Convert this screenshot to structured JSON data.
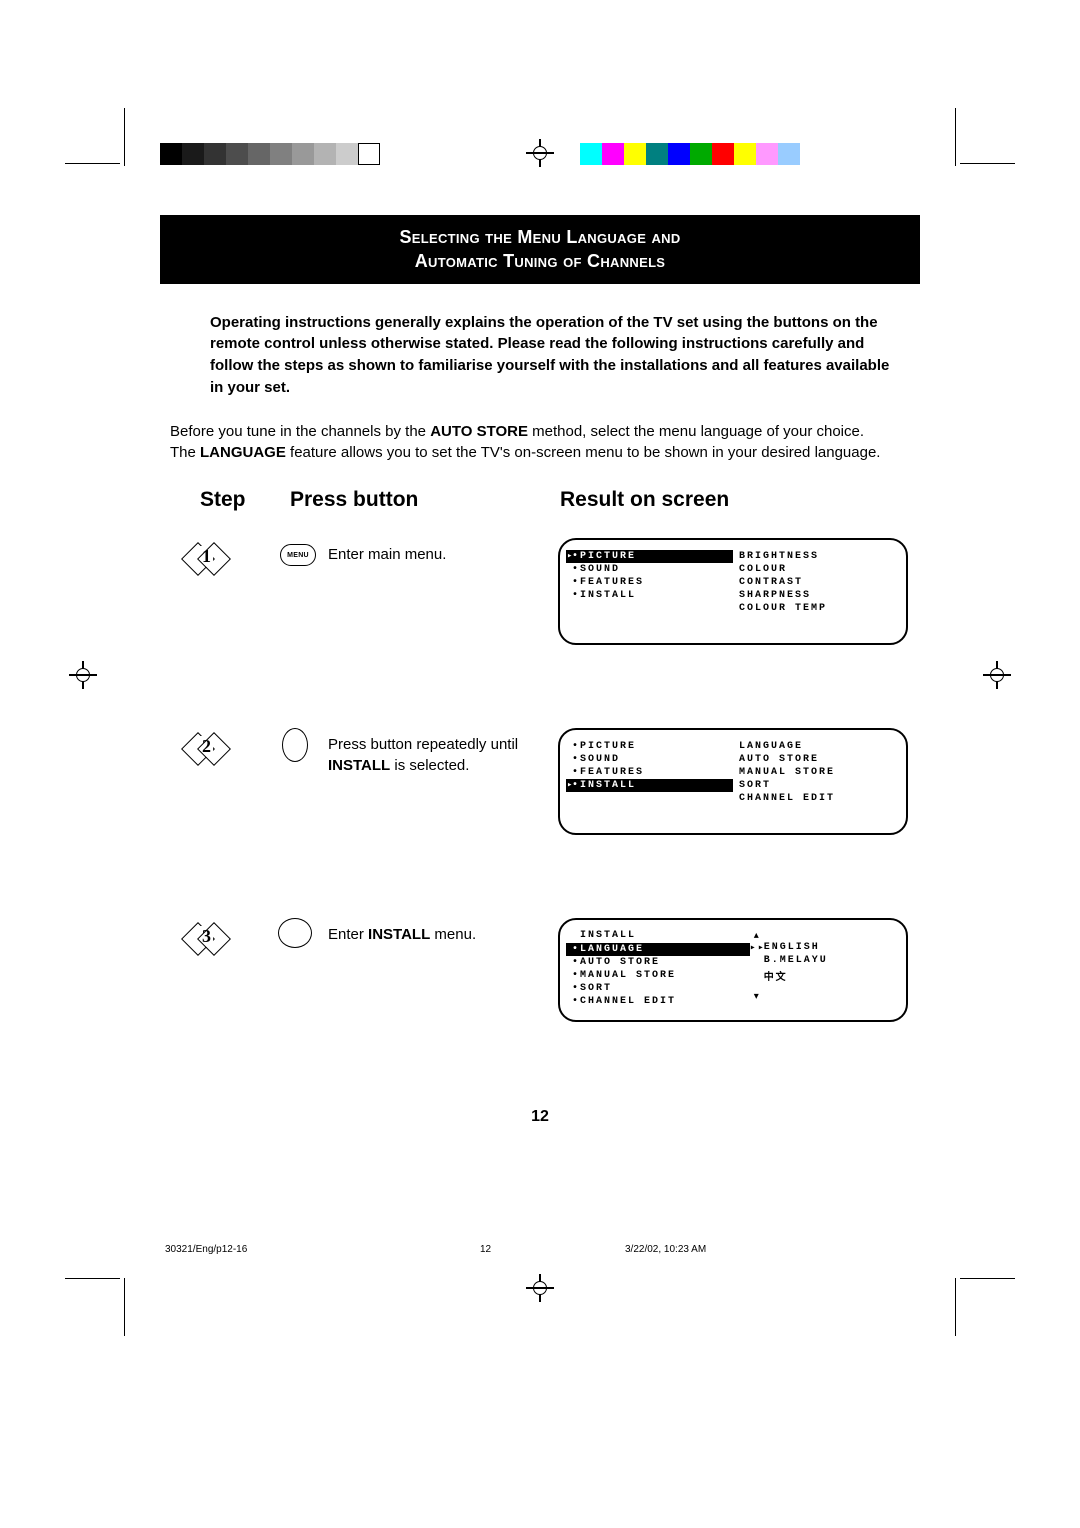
{
  "title": {
    "line1": "Selecting the Menu Language  and",
    "line2": "Automatic Tuning of Channels"
  },
  "intro_bold": "Operating instructions generally explains the operation of the TV set using the buttons on the remote control unless otherwise stated.  Please read the following instructions carefully and follow the steps as shown to familiarise yourself with the installations and all features available in your set.",
  "intro_normal_pre": "Before you tune in the channels by the ",
  "intro_normal_bold1": "AUTO STORE",
  "intro_normal_mid": " method, select the menu language of your choice.  The ",
  "intro_normal_bold2": "LANGUAGE",
  "intro_normal_post": " feature allows you to set the TV's on-screen menu to be shown in your desired language.",
  "headers": {
    "step": "Step",
    "press": "Press button",
    "result": "Result on screen"
  },
  "steps": {
    "s1": {
      "num": "1",
      "btn_label": "MENU",
      "text": "Enter main menu."
    },
    "s2": {
      "num": "2",
      "text_pre": "Press button repeatedly until ",
      "text_bold": "INSTALL",
      "text_post": " is selected."
    },
    "s3": {
      "num": "3",
      "text_pre": "Enter ",
      "text_bold": "INSTALL",
      "text_post": " menu."
    }
  },
  "screen1": {
    "left": [
      "PICTURE",
      "SOUND",
      "FEATURES",
      "INSTALL"
    ],
    "left_selected": 0,
    "right": [
      "BRIGHTNESS",
      "COLOUR",
      "CONTRAST",
      "SHARPNESS",
      "COLOUR TEMP"
    ]
  },
  "screen2": {
    "left": [
      "PICTURE",
      "SOUND",
      "FEATURES",
      "INSTALL"
    ],
    "left_selected": 3,
    "right": [
      "LANGUAGE",
      "AUTO STORE",
      "MANUAL STORE",
      "SORT",
      "CHANNEL EDIT"
    ]
  },
  "screen3": {
    "head": "INSTALL",
    "left": [
      "LANGUAGE",
      "AUTO STORE",
      "MANUAL STORE",
      "SORT",
      "CHANNEL EDIT"
    ],
    "left_selected": 0,
    "right": [
      "ENGLISH",
      "B.MELAYU",
      "中文"
    ],
    "right_selected": 0
  },
  "page_number": "12",
  "footer": {
    "left": "30321/Eng/p12-16",
    "mid": "12",
    "right": "3/22/02, 10:23 AM"
  }
}
